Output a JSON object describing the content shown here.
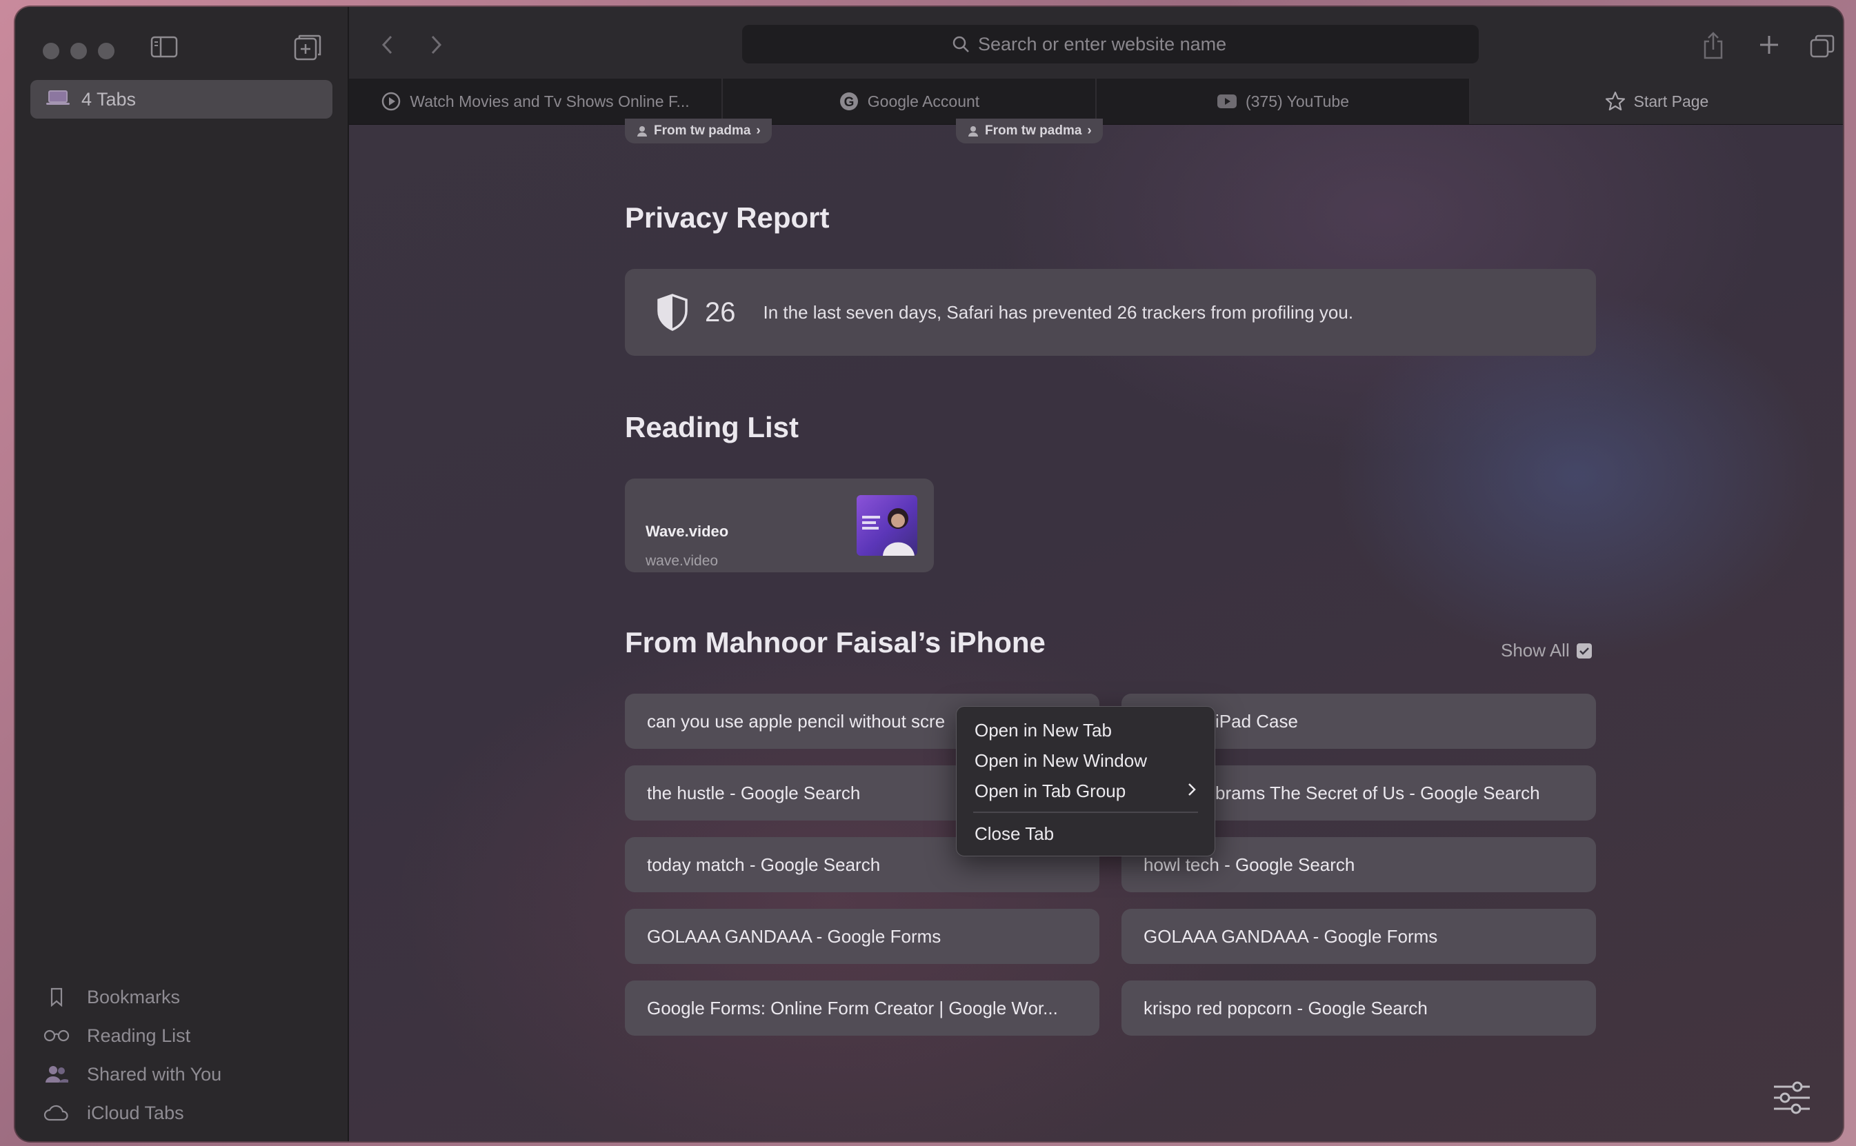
{
  "toolbar": {
    "search_placeholder": "Search or enter website name"
  },
  "sidebar": {
    "tab_group_label": "4 Tabs",
    "bottom_items": [
      {
        "label": "Bookmarks",
        "icon": "bookmark-icon"
      },
      {
        "label": "Reading List",
        "icon": "glasses-icon"
      },
      {
        "label": "Shared with You",
        "icon": "people-icon"
      },
      {
        "label": "iCloud Tabs",
        "icon": "cloud-icon"
      }
    ]
  },
  "tabs": [
    {
      "label": "Watch Movies and Tv Shows Online F...",
      "icon": "play-circle-icon"
    },
    {
      "label": "Google Account",
      "icon": "google-icon"
    },
    {
      "label": "(375) YouTube",
      "icon": "youtube-icon"
    },
    {
      "label": "Start Page",
      "icon": "star-icon",
      "active": true
    }
  ],
  "shared_pills": [
    {
      "label": "From tw padma"
    },
    {
      "label": "From tw padma"
    }
  ],
  "privacy": {
    "heading": "Privacy Report",
    "count": "26",
    "message": "In the last seven days, Safari has prevented 26 trackers from profiling you."
  },
  "reading_list": {
    "heading": "Reading List",
    "items": [
      {
        "title": "Wave.video",
        "url": "wave.video"
      }
    ]
  },
  "iphone": {
    "heading": "From Mahnoor Faisal’s iPhone",
    "show_all": "Show All",
    "left_tabs": [
      "can you use apple pencil without scre",
      "the hustle - Google Search",
      "today match - Google Search",
      "GOLAAA GANDAAA - Google Forms",
      "Google Forms: Online Form Creator | Google Wor..."
    ],
    "right_tabs": [
      "iPad Case",
      "brams The Secret of Us - Google Search",
      "howl tech - Google Search",
      "GOLAAA GANDAAA - Google Forms",
      "krispo red popcorn - Google Search"
    ]
  },
  "context_menu": {
    "items": [
      "Open in New Tab",
      "Open in New Window",
      "Open in Tab Group"
    ],
    "close_label": "Close Tab"
  },
  "colors": {
    "window_bg": "#2b282d",
    "card_bg": "#524d56",
    "accent_text": "#ebe8ee"
  }
}
